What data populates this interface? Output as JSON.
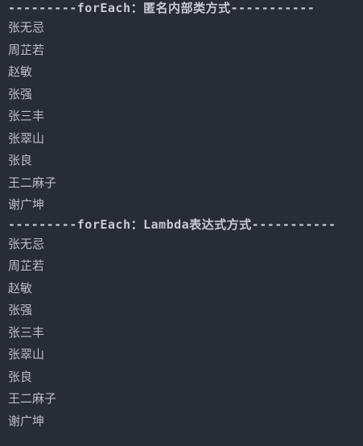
{
  "console": {
    "section1_header": "---------forEach：匿名内部类方式-----------",
    "section1_names": [
      "张无忌",
      "周芷若",
      "赵敏",
      "张强",
      "张三丰",
      "张翠山",
      "张良",
      "王二麻子",
      "谢广坤"
    ],
    "section2_header": "---------forEach：Lambda表达式方式-----------",
    "section2_names": [
      "张无忌",
      "周芷若",
      "赵敏",
      "张强",
      "张三丰",
      "张翠山",
      "张良",
      "王二麻子",
      "谢广坤"
    ]
  },
  "colors": {
    "background": "#282c34",
    "text": "#bbbec4"
  }
}
